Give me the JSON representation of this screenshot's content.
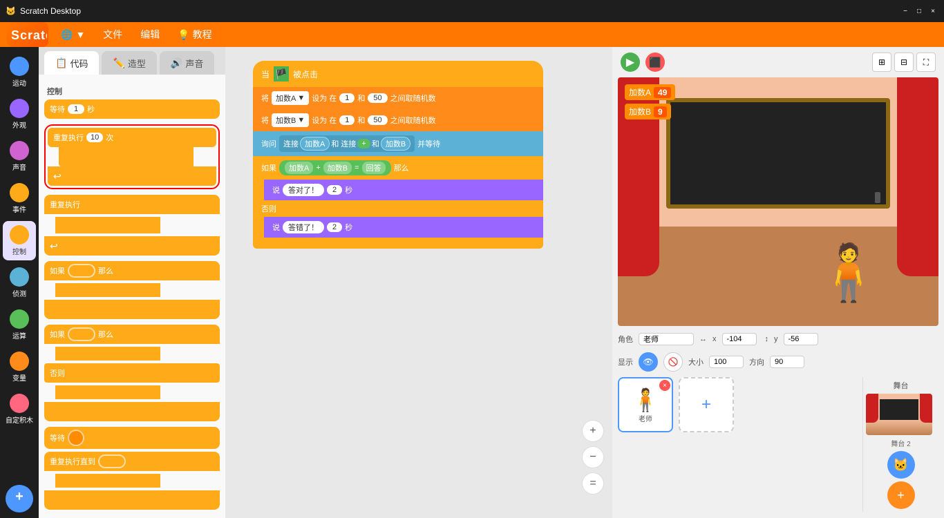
{
  "titlebar": {
    "title": "Scratch Desktop",
    "minimize": "−",
    "maximize": "□",
    "close": "×"
  },
  "menubar": {
    "logo": "Scratch",
    "globe_label": "🌐",
    "file_label": "文件",
    "edit_label": "编辑",
    "tutorial_label": "💡 教程"
  },
  "tabs": {
    "code_label": "代码",
    "costume_label": "造型",
    "sound_label": "声音"
  },
  "sidebar": {
    "items": [
      {
        "label": "运动",
        "color": "#4c97ff"
      },
      {
        "label": "外观",
        "color": "#9966ff"
      },
      {
        "label": "声音",
        "color": "#cf63cf"
      },
      {
        "label": "事件",
        "color": "#ffab19"
      },
      {
        "label": "控制",
        "color": "#ffab19"
      },
      {
        "label": "侦测",
        "color": "#5cb1d6"
      },
      {
        "label": "运算",
        "color": "#59c059"
      },
      {
        "label": "变量",
        "color": "#ff8c1a"
      },
      {
        "label": "自定积木",
        "color": "#ff6680"
      }
    ]
  },
  "blocks_section": "控制",
  "blocks": [
    {
      "label": "等待",
      "input": "1",
      "unit": "秒",
      "type": "orange"
    },
    {
      "label": "重复执行",
      "input": "10",
      "unit": "次",
      "type": "orange",
      "highlighted": true
    },
    {
      "label": "重复执行",
      "type": "orange"
    },
    {
      "label": "如果",
      "input": "那么",
      "type": "orange"
    },
    {
      "label": "如果",
      "input": "那么/否则",
      "type": "orange"
    },
    {
      "label": "等待",
      "input": "◉",
      "type": "orange"
    },
    {
      "label": "重复执行直到",
      "type": "orange"
    }
  ],
  "stage": {
    "var_a_label": "加数A",
    "var_a_value": "49",
    "var_b_label": "加数B",
    "var_b_value": "9"
  },
  "code_blocks": {
    "hat": "当 🏴 被点击",
    "block1_pre": "将",
    "block1_var": "加数A ▼",
    "block1_mid": "设为 在",
    "block1_n1": "1",
    "block1_n2": "50",
    "block1_suf": "之间取随机数",
    "block2_pre": "将",
    "block2_var": "加数B ▼",
    "block2_mid": "设为 在",
    "block2_n1": "1",
    "block2_n2": "50",
    "block2_suf": "之间取随机数",
    "block3_pre": "询问",
    "block3_a": "连接",
    "block3_b": "加数A",
    "block3_c": "和 连接",
    "block3_d": "+",
    "block3_e": "和",
    "block3_f": "加数B",
    "block3_suf": "并等待",
    "if_label": "如果",
    "block4_a": "加数A",
    "block4_b": "+",
    "block4_c": "加数B",
    "block4_eq": "=",
    "block4_d": "回答",
    "if_then": "那么",
    "say_label1": "说",
    "say_text1": "答对了！",
    "say_n1": "2",
    "say_unit1": "秒",
    "else_label": "否则",
    "say_label2": "说",
    "say_text2": "答错了！",
    "say_n2": "2",
    "say_unit2": "秒"
  },
  "sprite_props": {
    "role_label": "角色",
    "role_name": "老师",
    "x_label": "x",
    "x_value": "-104",
    "y_label": "y",
    "y_value": "-56",
    "show_label": "显示",
    "size_label": "大小",
    "size_value": "100",
    "dir_label": "方向",
    "dir_value": "90"
  },
  "sprite_list": [
    {
      "name": "老师",
      "selected": true
    }
  ],
  "backdrop": {
    "label": "舞台",
    "count": "2"
  },
  "zoom": {
    "in": "+",
    "out": "−",
    "reset": "="
  }
}
